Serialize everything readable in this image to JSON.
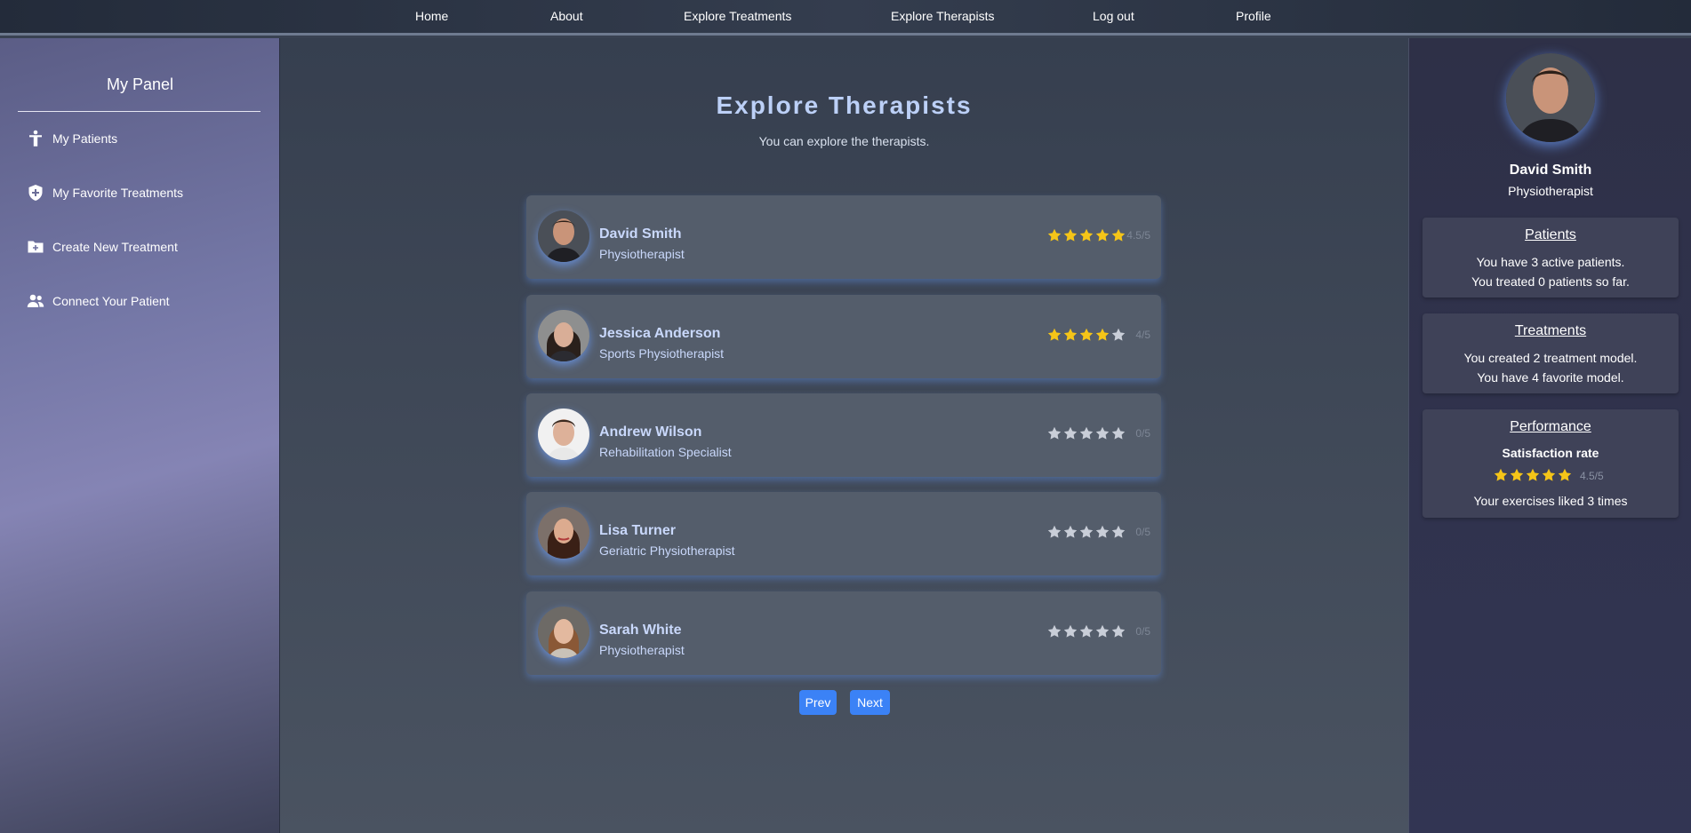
{
  "nav": {
    "home": "Home",
    "about": "About",
    "explore_treatments": "Explore Treatments",
    "explore_therapists": "Explore Therapists",
    "logout": "Log out",
    "profile": "Profile"
  },
  "sidebar": {
    "title": "My Panel",
    "items": [
      {
        "label": "My Patients",
        "icon": "person-icon"
      },
      {
        "label": "My Favorite Treatments",
        "icon": "shield-plus-icon"
      },
      {
        "label": "Create New Treatment",
        "icon": "folder-plus-icon"
      },
      {
        "label": "Connect Your Patient",
        "icon": "users-icon"
      }
    ]
  },
  "main": {
    "title": "Explore Therapists",
    "subtitle": "You can explore the therapists.",
    "therapists": [
      {
        "name": "David Smith",
        "role": "Physiotherapist",
        "rating": "4.5/5",
        "stars": 4.5
      },
      {
        "name": "Jessica Anderson",
        "role": "Sports Physiotherapist",
        "rating": "4/5",
        "stars": 4
      },
      {
        "name": "Andrew Wilson",
        "role": "Rehabilitation Specialist",
        "rating": "0/5",
        "stars": 0
      },
      {
        "name": "Lisa Turner",
        "role": "Geriatric Physiotherapist",
        "rating": "0/5",
        "stars": 0
      },
      {
        "name": "Sarah White",
        "role": "Physiotherapist",
        "rating": "0/5",
        "stars": 0
      }
    ],
    "prev_label": "Prev",
    "next_label": "Next"
  },
  "profile": {
    "name": "David Smith",
    "role": "Physiotherapist",
    "patients": {
      "title": "Patients",
      "line1": "You have 3 active patients.",
      "line2": "You treated 0 patients so far."
    },
    "treatments": {
      "title": "Treatments",
      "line1": "You created 2 treatment model.",
      "line2": "You have 4 favorite model."
    },
    "performance": {
      "title": "Performance",
      "label": "Satisfaction rate",
      "rating": "4.5/5",
      "stars": 4.5,
      "likes": "Your exercises liked 3 times"
    }
  },
  "colors": {
    "star_filled": "#f5c518",
    "star_empty": "#c9ced8",
    "accent": "#3b82f6",
    "title": "#bcd0f7"
  }
}
